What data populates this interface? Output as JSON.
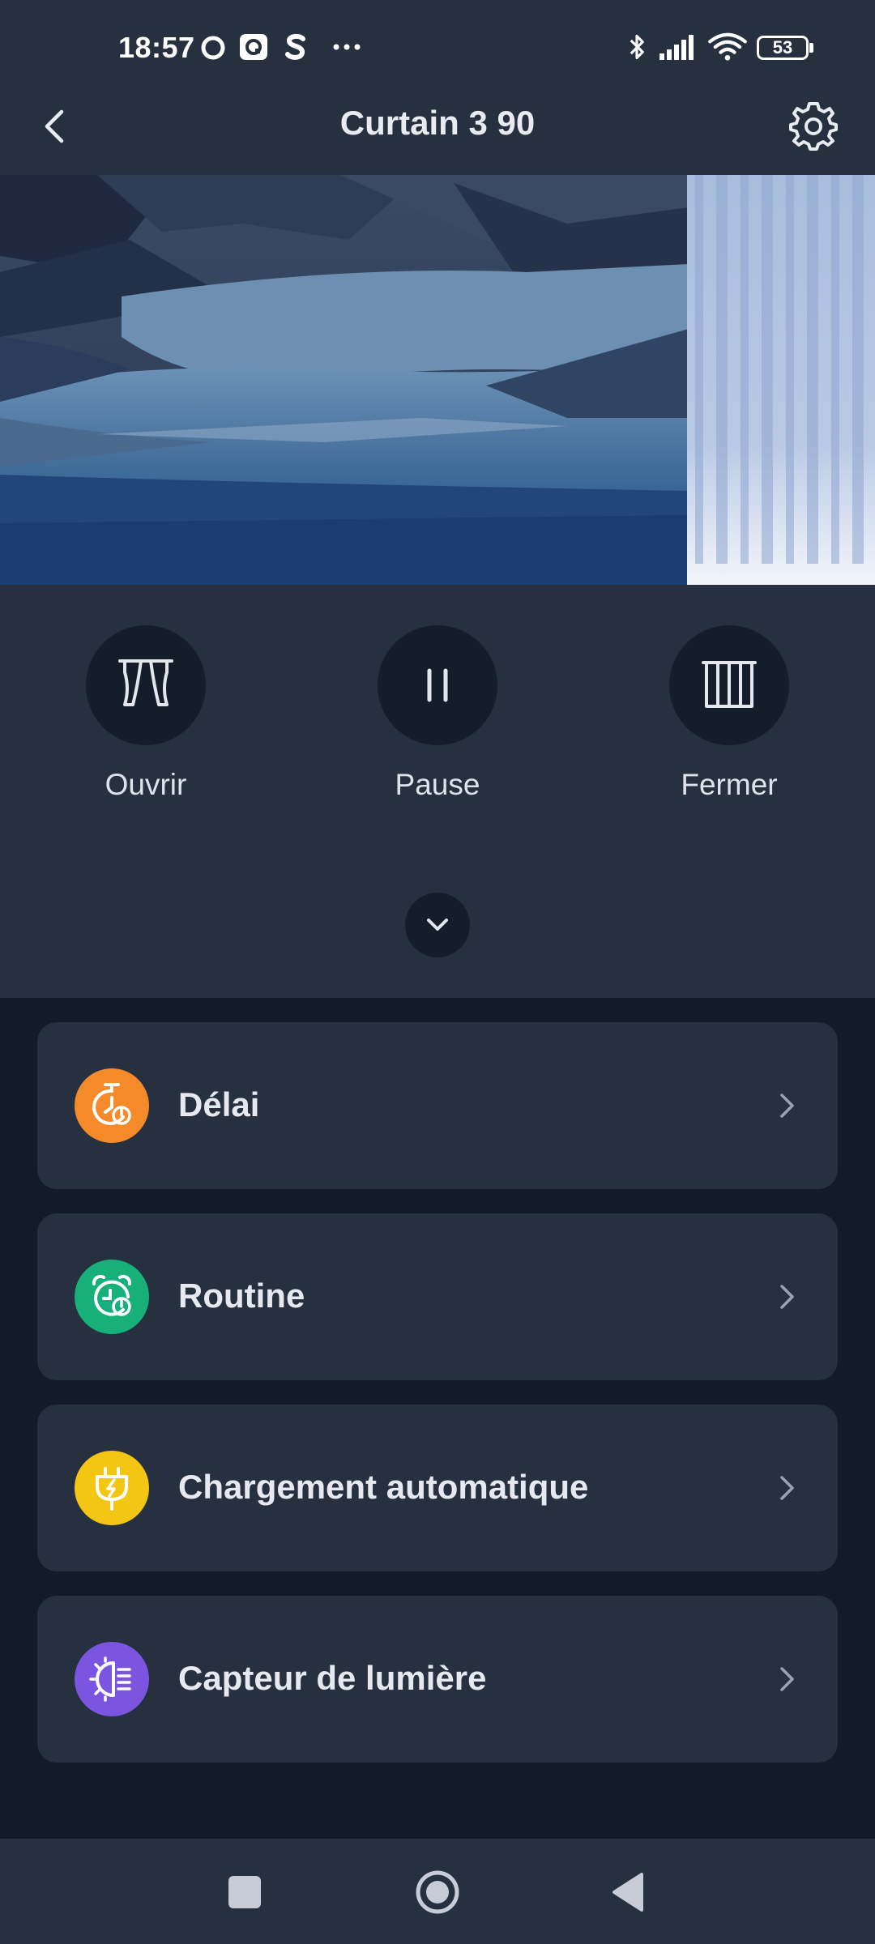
{
  "status_bar": {
    "time": "18:57",
    "battery": "53",
    "icons": [
      "circle-notification-icon",
      "app-notification-icon",
      "s-notification-icon",
      "more-dots-icon",
      "bluetooth-icon",
      "signal-icon",
      "wifi-icon",
      "battery-icon"
    ]
  },
  "header": {
    "title": "Curtain 3 90",
    "back_icon": "chevron-left-icon",
    "settings_icon": "gear-icon"
  },
  "controls": [
    {
      "label": "Ouvrir",
      "icon": "curtain-open-icon"
    },
    {
      "label": "Pause",
      "icon": "pause-icon"
    },
    {
      "label": "Fermer",
      "icon": "curtain-closed-icon"
    }
  ],
  "expand_icon": "chevron-down-icon",
  "menu": [
    {
      "label": "Délai",
      "icon": "timer-icon",
      "color": "#f58a2b"
    },
    {
      "label": "Routine",
      "icon": "alarm-clock-icon",
      "color": "#17b07a"
    },
    {
      "label": "Chargement automatique",
      "icon": "plug-charge-icon",
      "color": "#f3c613"
    },
    {
      "label": "Capteur de lumière",
      "icon": "light-sensor-icon",
      "color": "#7b55e0"
    }
  ],
  "nav": [
    "square-icon",
    "circle-home-icon",
    "triangle-back-icon"
  ]
}
